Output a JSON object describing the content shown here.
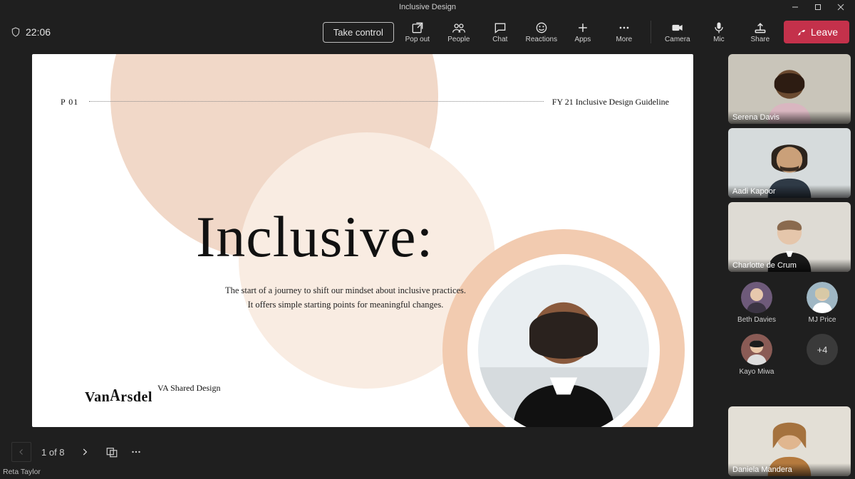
{
  "window": {
    "title": "Inclusive Design"
  },
  "meeting": {
    "timer": "22:06",
    "control_button": "Take control",
    "leave_label": "Leave",
    "presenter": "Reta Taylor"
  },
  "toolbar": {
    "items": [
      {
        "id": "popout",
        "label": "Pop out"
      },
      {
        "id": "people",
        "label": "People"
      },
      {
        "id": "chat",
        "label": "Chat"
      },
      {
        "id": "reactions",
        "label": "Reactions"
      },
      {
        "id": "apps",
        "label": "Apps"
      },
      {
        "id": "more",
        "label": "More"
      }
    ],
    "devices": [
      {
        "id": "camera",
        "label": "Camera"
      },
      {
        "id": "mic",
        "label": "Mic"
      },
      {
        "id": "share",
        "label": "Share"
      }
    ]
  },
  "slide": {
    "page_marker": "P 01",
    "guideline_label": "FY 21 Inclusive Design Guideline",
    "headline": "Inclusive:",
    "sub_line1": "The start of a journey to shift our mindset about inclusive practices.",
    "sub_line2": "It offers simple starting points for meaningful changes.",
    "brand_line": "VA Shared Design",
    "logo_prefix": "Van",
    "logo_mid": "A",
    "logo_suffix": "rsdel",
    "nav": {
      "current": 1,
      "total": 8,
      "text": "1 of 8"
    }
  },
  "participants": {
    "tiles": [
      {
        "name": "Serena Davis",
        "bg": "#c9c5ba",
        "skin": "#6b4a30",
        "shirt": "#d9b6c0"
      },
      {
        "name": "Aadi Kapoor",
        "bg": "#d6dbdc",
        "skin": "#caa079",
        "shirt": "#2f3a46"
      },
      {
        "name": "Charlotte de Crum",
        "bg": "#dedbd4",
        "skin": "#e5c6ab",
        "shirt": "#1a1a1a"
      }
    ],
    "avatars": [
      {
        "name": "Beth Davies",
        "bg": "#6e5a7a"
      },
      {
        "name": "MJ Price",
        "bg": "#9fb7c4"
      },
      {
        "name": "Kayo Miwa",
        "bg": "#8a5b55"
      }
    ],
    "overflow": "+4",
    "self": {
      "name": "Daniela Mandera",
      "bg": "#e3dfd6",
      "skin": "#e0b68f",
      "shirt": "#b57a3e"
    }
  }
}
